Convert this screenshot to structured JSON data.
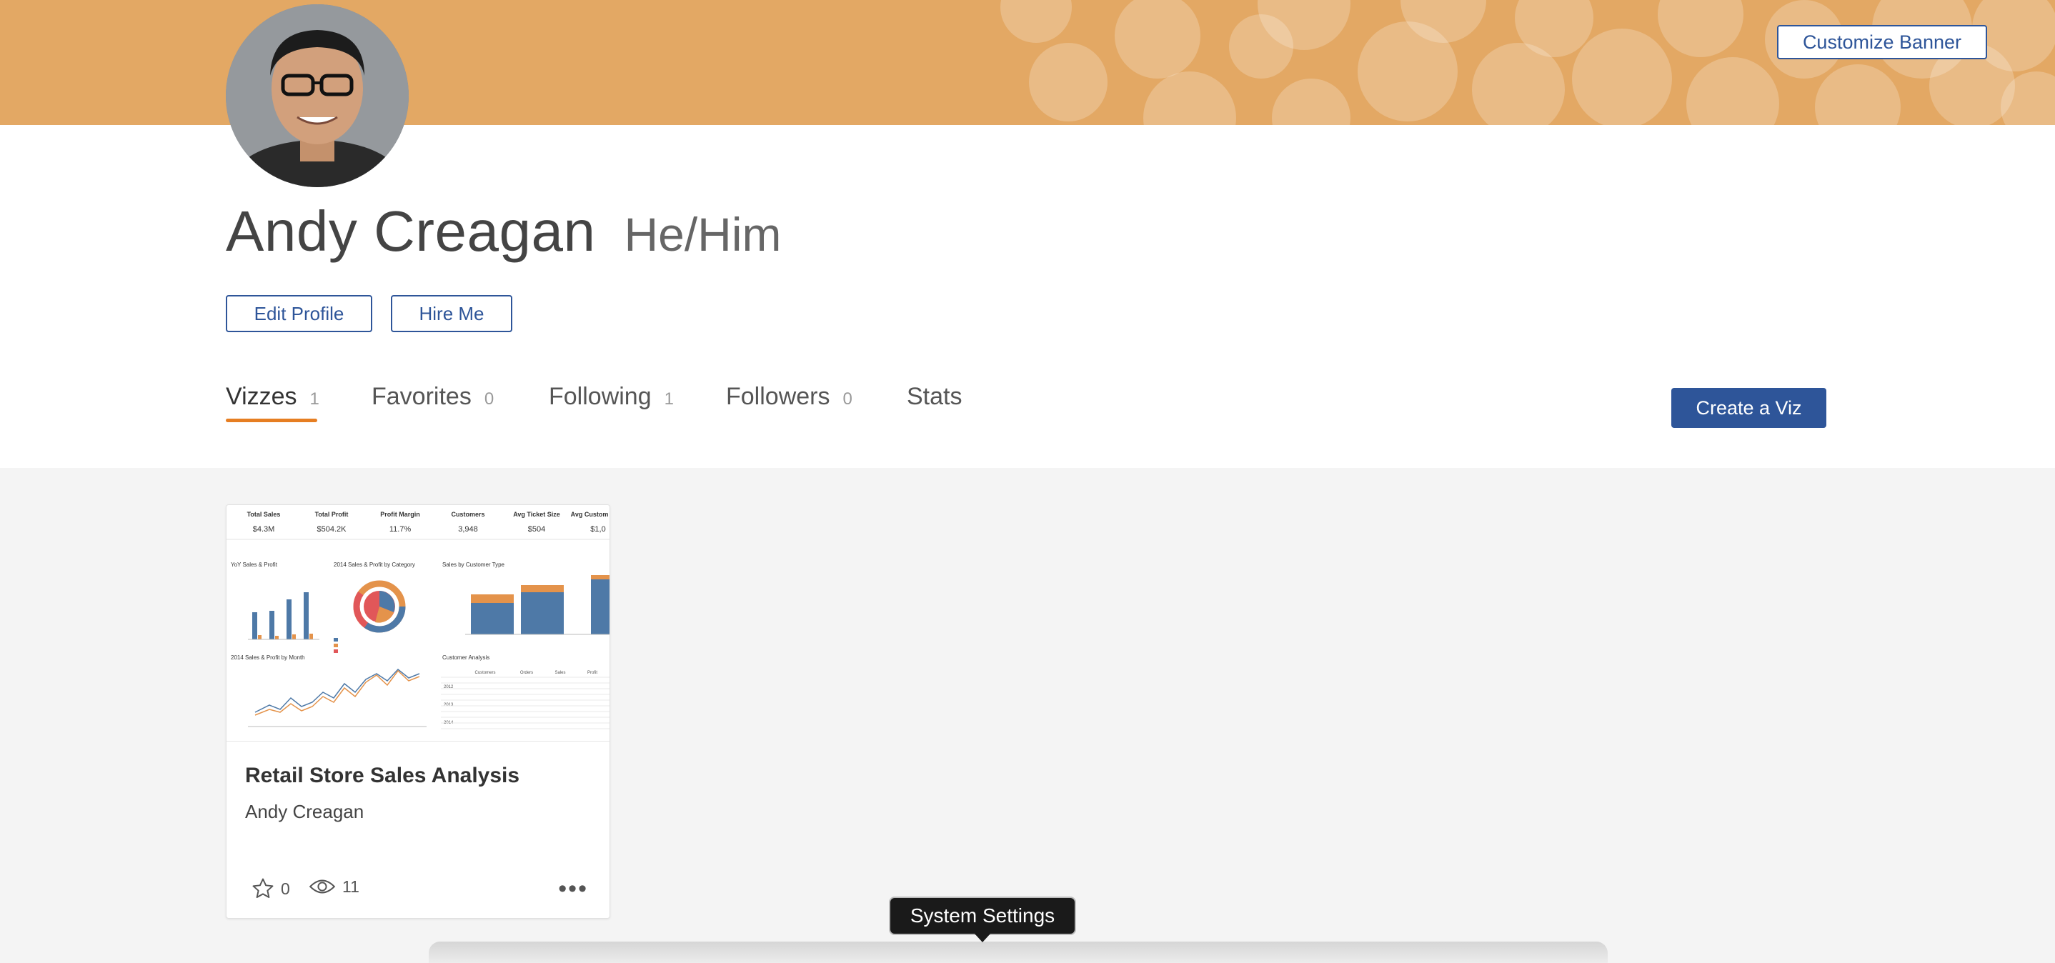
{
  "banner": {
    "customize_label": "Customize Banner",
    "color": "#e3a864"
  },
  "profile": {
    "name": "Andy Creagan",
    "pronouns": "He/Him",
    "edit_label": "Edit Profile",
    "hire_label": "Hire Me"
  },
  "tabs": [
    {
      "label": "Vizzes",
      "count": "1"
    },
    {
      "label": "Favorites",
      "count": "0"
    },
    {
      "label": "Following",
      "count": "1"
    },
    {
      "label": "Followers",
      "count": "0"
    },
    {
      "label": "Stats",
      "count": ""
    }
  ],
  "create_label": "Create a Viz",
  "card": {
    "title": "Retail Store Sales Analysis",
    "author": "Andy Creagan",
    "favorites": "0",
    "views": "11",
    "thumb": {
      "kpis": [
        {
          "label": "Total Sales",
          "value": "$4.3M"
        },
        {
          "label": "Total Profit",
          "value": "$504.2K"
        },
        {
          "label": "Profit Margin",
          "value": "11.7%"
        },
        {
          "label": "Customers",
          "value": "3,948"
        },
        {
          "label": "Avg Ticket Size",
          "value": "$504"
        },
        {
          "label": "Avg Custom",
          "value": "$1,0"
        }
      ],
      "chart1_title": "YoY Sales & Profit",
      "chart2_title": "2014 Sales & Profit by Category",
      "chart3_title": "Sales by Customer Type",
      "chart4_title": "2014 Sales & Profit by Month",
      "table_title": "Customer Analysis",
      "table_headers": [
        "Customers",
        "Orders",
        "Sales",
        "Profit"
      ],
      "table_years": [
        "2012",
        "2013",
        "2014"
      ]
    }
  },
  "tooltip": "System Settings",
  "colors": {
    "accent": "#2e5599",
    "tab_underline": "#e67e22"
  }
}
